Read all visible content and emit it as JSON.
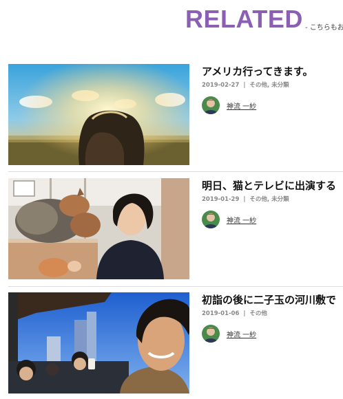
{
  "section": {
    "title": "RELATED",
    "subtitle": "- こちらもお"
  },
  "posts": [
    {
      "title": "アメリカ行ってきます。",
      "date": "2019-02-27",
      "categories": "その他, 未分類",
      "author": "神流 一紗",
      "thumbnail_icon": "sunset-portrait-photo"
    },
    {
      "title": "明日、猫とテレビに出演する",
      "date": "2019-01-29",
      "categories": "その他, 未分類",
      "author": "神流 一紗",
      "thumbnail_icon": "man-with-cat-photo"
    },
    {
      "title": "初詣の後に二子玉の河川敷で",
      "date": "2019-01-06",
      "categories": "その他",
      "author": "神流 一紗",
      "thumbnail_icon": "selfie-group-photo"
    }
  ],
  "meta_separator": "|",
  "colors": {
    "accent": "#8b5fb3",
    "meta": "#888888",
    "divider": "#dcdcdc"
  }
}
